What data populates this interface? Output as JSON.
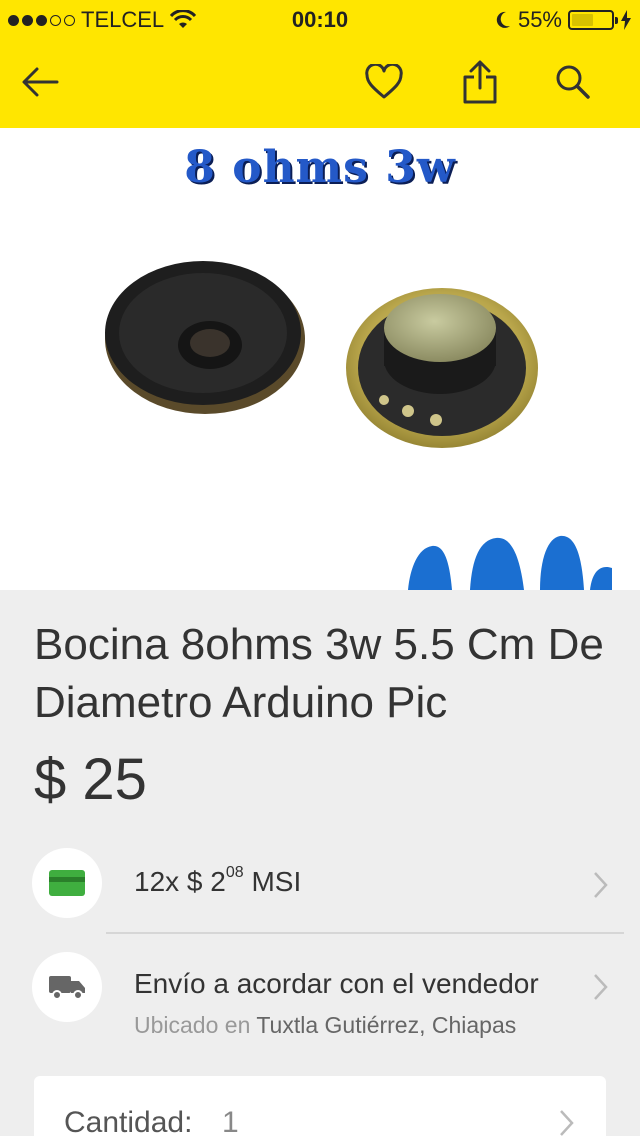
{
  "status_bar": {
    "carrier": "TELCEL",
    "time": "00:10",
    "battery": "55%",
    "battery_level": 0.55
  },
  "gallery": {
    "image_caption": "8 ohms 3w"
  },
  "product": {
    "title": "Bocina 8ohms 3w 5.5 Cm De Diametro Arduino Pic",
    "price": "$ 25"
  },
  "installments": {
    "prefix": "12x $ 2",
    "cents": "08",
    "suffix": "MSI"
  },
  "shipping": {
    "label": "Envío a acordar con el vendedor",
    "location_prefix": "Ubicado en",
    "location": "Tuxtla Gutiérrez, Chiapas"
  },
  "quantity": {
    "label": "Cantidad:",
    "value": "1"
  },
  "colors": {
    "header": "#ffe600",
    "background": "#eeeeee",
    "card_icon": "#3fae3f",
    "truck_icon": "#666666"
  },
  "icons": {
    "back": "arrow-left",
    "favorite": "heart-outline",
    "share": "share-box-arrow",
    "search": "magnifier",
    "card": "credit-card",
    "truck": "delivery-truck",
    "chevron": "chevron-right"
  }
}
